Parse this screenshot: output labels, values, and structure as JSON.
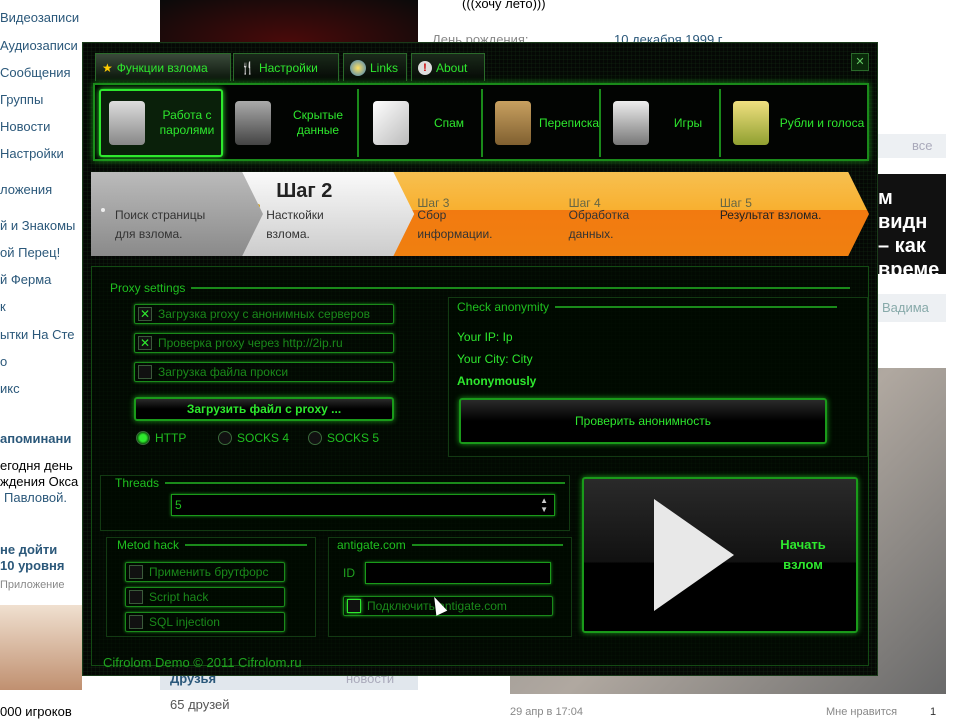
{
  "background": {
    "left_menu": [
      "Видеозаписи",
      "Аудиозаписи",
      "Сообщения",
      "Группы",
      "Новости",
      "Настройки",
      "ложения",
      "й и Знакомы",
      "ой Перец!",
      "й Ферма",
      "к",
      "ытки На Сте",
      "о",
      "икс"
    ],
    "reminder_title": "апоминани",
    "reminder_lines": [
      "егодня день",
      "ждения Окса",
      "Павловой."
    ],
    "app_promo": [
      "не дойти",
      "10 уровня"
    ],
    "app_label": "Приложение",
    "players": "000 игроков",
    "status": "(((хочу лето)))",
    "birthday_label": "День рождения:",
    "birthday_value": "10 декабря 1999 г.",
    "friends_label": "Друзья",
    "news_label": "новости",
    "friends_count": "65 друзей",
    "all_link": "все",
    "video_lines": [
      "м видн",
      "– как",
      "време"
    ],
    "vadima": "Вадима",
    "post_date": "29 апр в 17:04",
    "like_label": "Мне нравится",
    "like_count": "1"
  },
  "tabs": [
    {
      "label": "Функции взлома",
      "icon": "star-icon"
    },
    {
      "label": "Настройки",
      "icon": "tools-icon"
    },
    {
      "label": "Links",
      "icon": "globe-icon"
    },
    {
      "label": "About",
      "icon": "info-icon"
    }
  ],
  "tools": [
    {
      "label": "Работа с паролями",
      "icon": "keys-icon"
    },
    {
      "label": "Скрытые данные",
      "icon": "safe-icon"
    },
    {
      "label": "Спам",
      "icon": "envelope-icon"
    },
    {
      "label": "Переписка",
      "icon": "chat-icon"
    },
    {
      "label": "Игры",
      "icon": "gamepad-icon"
    },
    {
      "label": "Рубли и голоса",
      "icon": "money-bag-icon"
    }
  ],
  "steps": [
    {
      "title": "",
      "text": [
        "Поиск страницы",
        "для взлома."
      ]
    },
    {
      "title": "Шаг 2",
      "text": [
        "Насткойки",
        "взлома."
      ]
    },
    {
      "title": "Шаг  3",
      "text": [
        "Сбор",
        "информации."
      ]
    },
    {
      "title": "Шаг  4",
      "text": [
        "Обработка",
        "данных."
      ]
    },
    {
      "title": "Шаг  5",
      "text": [
        "Результат взлома."
      ]
    }
  ],
  "proxy": {
    "legend": "Proxy settings",
    "options": [
      {
        "label": "Загрузка proxy с анонимных серверов",
        "checked": true
      },
      {
        "label": "Проверка proxy через http://2ip.ru",
        "checked": true
      },
      {
        "label": "Загрузка файла прокси",
        "checked": false
      }
    ],
    "load_button": "Загрузить файл с proxy ...",
    "protocols": [
      {
        "label": "HTTP",
        "selected": true
      },
      {
        "label": "SOCKS 4",
        "selected": false
      },
      {
        "label": "SOCKS 5",
        "selected": false
      }
    ]
  },
  "anonymity": {
    "legend": "Check anonymity",
    "ip": "Your IP: Ip",
    "city": "Your City: City",
    "status": "Anonymously",
    "button": "Проверить анонимность"
  },
  "threads": {
    "legend": "Threads",
    "value": "5"
  },
  "method": {
    "legend": "Metod hack",
    "options": [
      {
        "label": "Применить брутфорс",
        "checked": false
      },
      {
        "label": "Script hack",
        "checked": false
      },
      {
        "label": "SQL injection",
        "checked": false
      }
    ]
  },
  "antigate": {
    "legend": "antigate.com",
    "id_label": "ID",
    "id_value": "",
    "connect_label": "Подключить antigate.com",
    "connect_checked": false
  },
  "start_button": "Начать взлом",
  "footer": "Cifrolom Demo © 2011 Cifrolom.ru",
  "colors": {
    "accent": "#2ee82e",
    "step_orange": "#f08010"
  }
}
